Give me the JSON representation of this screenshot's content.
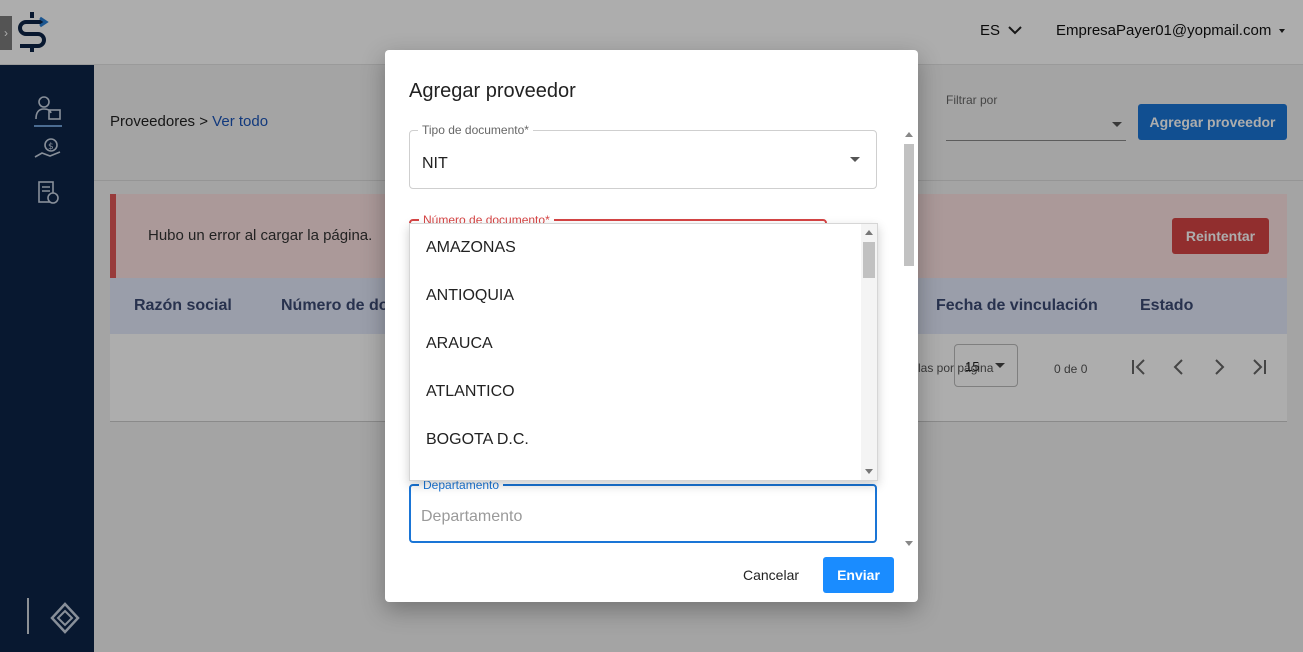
{
  "header": {
    "language": "ES",
    "user_email": "EmpresaPayer01@yopmail.com"
  },
  "sidebar": {
    "items": [
      {
        "icon": "supplier-icon"
      },
      {
        "icon": "money-hand-icon"
      },
      {
        "icon": "document-money-icon"
      }
    ]
  },
  "breadcrumb": {
    "section": "Proveedores",
    "separator": ">",
    "current": "Ver todo"
  },
  "filter": {
    "label": "Filtrar por",
    "value": ""
  },
  "actions": {
    "add_supplier": "Agregar proveedor"
  },
  "error": {
    "message": "Hubo un error al cargar la página.",
    "retry": "Reintentar"
  },
  "table": {
    "columns": [
      "Razón social",
      "Número de documento",
      "Fecha de vinculación",
      "Estado"
    ]
  },
  "pagination": {
    "rows_label": "Filas por página",
    "rows_per_page": "15",
    "count": "0 de 0"
  },
  "modal": {
    "title": "Agregar proveedor",
    "doc_type": {
      "label": "Tipo de documento*",
      "value": "NIT"
    },
    "doc_number": {
      "label": "Número de documento*",
      "value": ""
    },
    "department": {
      "label": "Departamento",
      "placeholder": "Departamento",
      "value": ""
    },
    "cancel": "Cancelar",
    "submit": "Enviar"
  },
  "department_options": [
    "AMAZONAS",
    "ANTIOQUIA",
    "ARAUCA",
    "ATLANTICO",
    "BOGOTA D.C."
  ],
  "colors": {
    "primary": "#1a75d6",
    "sidebar": "#0c2448",
    "error_bg": "#fde2e2",
    "error_accent": "#d64545",
    "table_header": "#e3e9fb"
  }
}
